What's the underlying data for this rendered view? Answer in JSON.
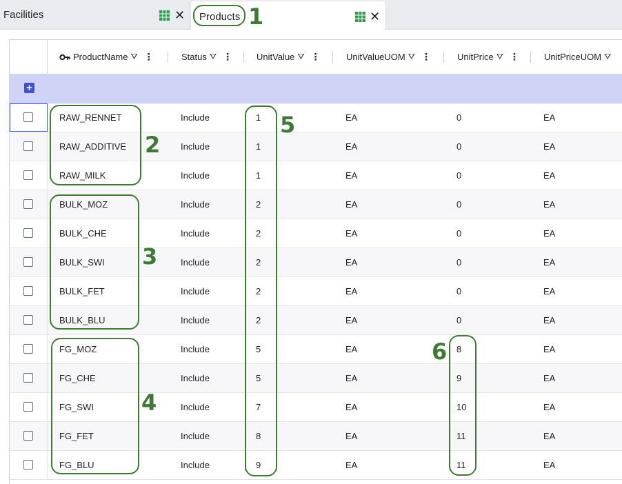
{
  "tabs": [
    {
      "label": "Facilities",
      "icon": "table-icon",
      "close_glyph": "✕"
    },
    {
      "label": "Products",
      "icon": "table-icon",
      "close_glyph": "✕"
    }
  ],
  "grid": {
    "add_glyph": "+",
    "columns": [
      {
        "label": "ProductName",
        "key_icon": true
      },
      {
        "label": "Status"
      },
      {
        "label": "UnitValue"
      },
      {
        "label": "UnitValueUOM"
      },
      {
        "label": "UnitPrice"
      },
      {
        "label": "UnitPriceUOM"
      }
    ],
    "header_glyphs": {
      "filter": "⛛",
      "menu": "⋮"
    },
    "rows": [
      {
        "ProductName": "RAW_RENNET",
        "Status": "Include",
        "UnitValue": "1",
        "UnitValueUOM": "EA",
        "UnitPrice": "0",
        "UnitPriceUOM": "EA"
      },
      {
        "ProductName": "RAW_ADDITIVE",
        "Status": "Include",
        "UnitValue": "1",
        "UnitValueUOM": "EA",
        "UnitPrice": "0",
        "UnitPriceUOM": "EA"
      },
      {
        "ProductName": "RAW_MILK",
        "Status": "Include",
        "UnitValue": "1",
        "UnitValueUOM": "EA",
        "UnitPrice": "0",
        "UnitPriceUOM": "EA"
      },
      {
        "ProductName": "BULK_MOZ",
        "Status": "Include",
        "UnitValue": "2",
        "UnitValueUOM": "EA",
        "UnitPrice": "0",
        "UnitPriceUOM": "EA"
      },
      {
        "ProductName": "BULK_CHE",
        "Status": "Include",
        "UnitValue": "2",
        "UnitValueUOM": "EA",
        "UnitPrice": "0",
        "UnitPriceUOM": "EA"
      },
      {
        "ProductName": "BULK_SWI",
        "Status": "Include",
        "UnitValue": "2",
        "UnitValueUOM": "EA",
        "UnitPrice": "0",
        "UnitPriceUOM": "EA"
      },
      {
        "ProductName": "BULK_FET",
        "Status": "Include",
        "UnitValue": "2",
        "UnitValueUOM": "EA",
        "UnitPrice": "0",
        "UnitPriceUOM": "EA"
      },
      {
        "ProductName": "BULK_BLU",
        "Status": "Include",
        "UnitValue": "2",
        "UnitValueUOM": "EA",
        "UnitPrice": "0",
        "UnitPriceUOM": "EA"
      },
      {
        "ProductName": "FG_MOZ",
        "Status": "Include",
        "UnitValue": "5",
        "UnitValueUOM": "EA",
        "UnitPrice": "8",
        "UnitPriceUOM": "EA"
      },
      {
        "ProductName": "FG_CHE",
        "Status": "Include",
        "UnitValue": "5",
        "UnitValueUOM": "EA",
        "UnitPrice": "9",
        "UnitPriceUOM": "EA"
      },
      {
        "ProductName": "FG_SWI",
        "Status": "Include",
        "UnitValue": "7",
        "UnitValueUOM": "EA",
        "UnitPrice": "10",
        "UnitPriceUOM": "EA"
      },
      {
        "ProductName": "FG_FET",
        "Status": "Include",
        "UnitValue": "8",
        "UnitValueUOM": "EA",
        "UnitPrice": "11",
        "UnitPriceUOM": "EA"
      },
      {
        "ProductName": "FG_BLU",
        "Status": "Include",
        "UnitValue": "9",
        "UnitValueUOM": "EA",
        "UnitPrice": "11",
        "UnitPriceUOM": "EA"
      }
    ]
  },
  "annotations": {
    "color": "#3f7a35",
    "labels": [
      "1",
      "2",
      "3",
      "4",
      "5",
      "6"
    ]
  },
  "colors": {
    "add_row_band": "#cfd4f7",
    "add_button": "#4252d6",
    "grid_icon": "#2e9e4f"
  }
}
